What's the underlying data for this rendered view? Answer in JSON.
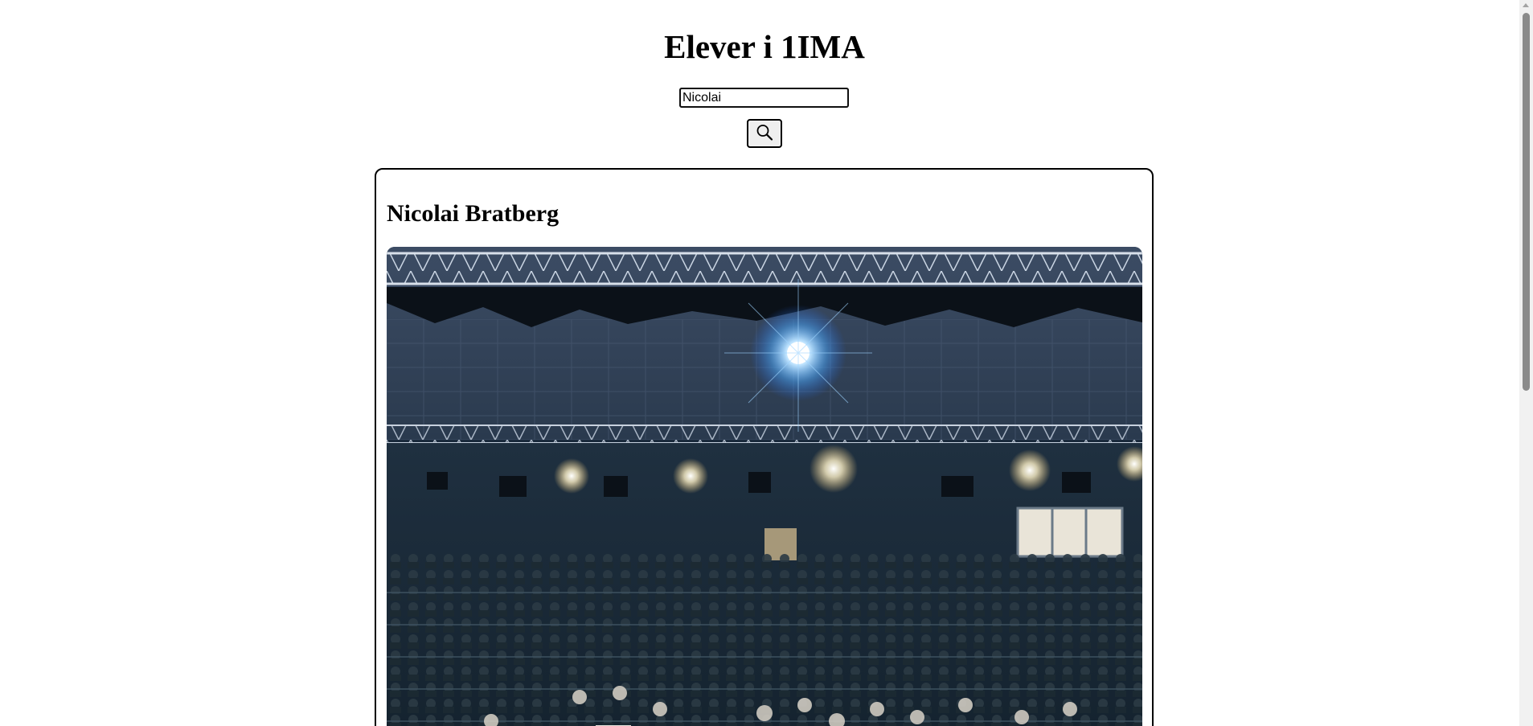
{
  "page": {
    "title": "Elever i 1IMA"
  },
  "search": {
    "value": "Nicolai",
    "button_icon": "search-icon"
  },
  "result": {
    "name": "Nicolai Bratberg",
    "photo_icon": "group-photo"
  },
  "scrollbar": {
    "icon": "scroll-up-arrow-icon"
  }
}
